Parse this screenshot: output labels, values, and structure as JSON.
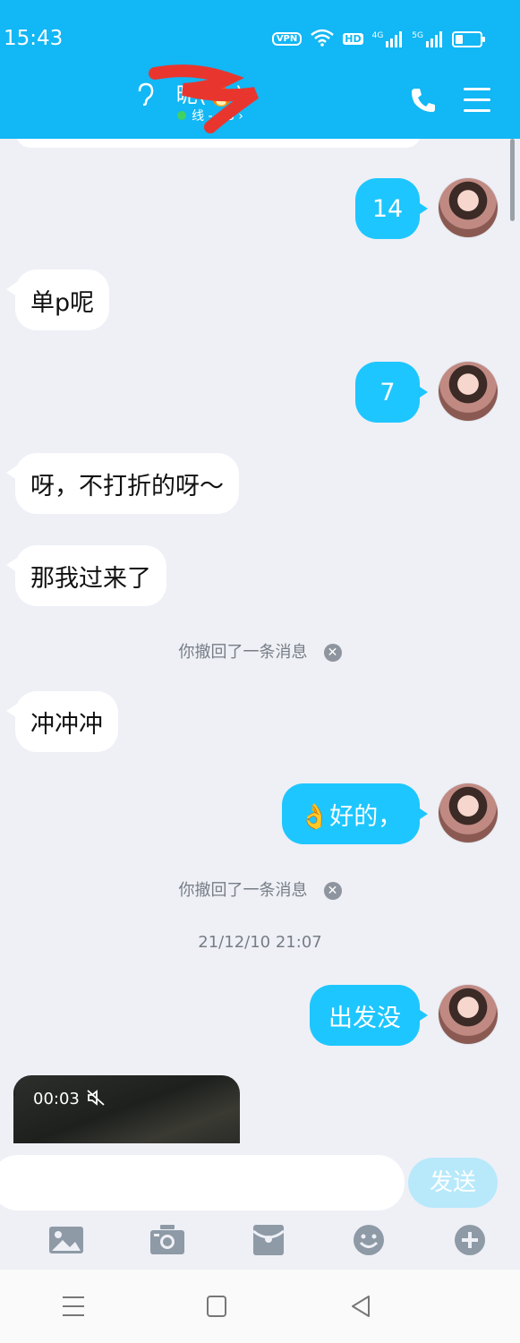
{
  "status_bar": {
    "time": "15:43",
    "vpn": "VPN",
    "hd": "HD",
    "net1": "4G",
    "net2": "5G"
  },
  "header": {
    "title": "昵(🔥)",
    "subtitle": "线 - 4G ›"
  },
  "messages": {
    "m1": "14",
    "m2": "单p呢",
    "m3": "7",
    "m4": "呀，不打折的呀～",
    "m5": "那我过来了",
    "recall1": "你撤回了一条消息",
    "m6": "冲冲冲",
    "m7": "👌好的，",
    "recall2": "你撤回了一条消息",
    "timestamp": "21/12/10 21:07",
    "m8": "出发没",
    "video_duration": "00:03"
  },
  "input": {
    "placeholder": "",
    "send_label": "发送"
  },
  "colors": {
    "header": "#12b7f5",
    "my_bubble": "#1ec6ff",
    "send_disabled": "#b7e9fb",
    "background": "#eef0f6"
  },
  "icons": {
    "ear": "ear-icon",
    "phone": "phone-icon",
    "menu": "menu-icon",
    "image": "image-icon",
    "camera": "camera-icon",
    "red_packet": "red-packet-icon",
    "emoji": "emoji-icon",
    "plus": "plus-icon",
    "mute": "mute-icon"
  }
}
